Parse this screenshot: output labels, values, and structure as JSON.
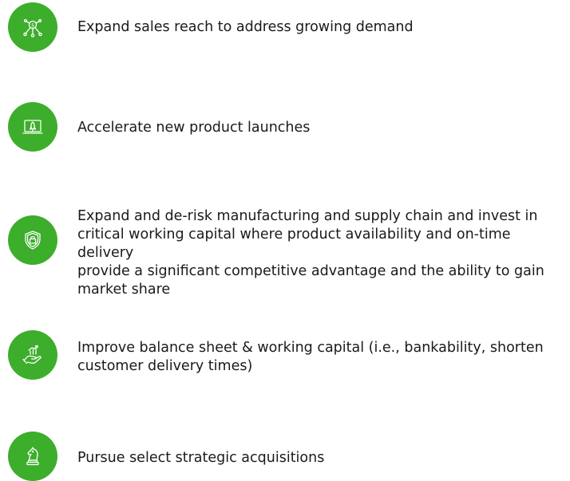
{
  "theme": {
    "accent": "#3dae2b",
    "icon_stroke": "#ffffff",
    "text_color": "#1a1a1a"
  },
  "items": [
    {
      "icon": "sales-network-icon",
      "text": "Expand sales reach to address growing demand"
    },
    {
      "icon": "rocket-launch-icon",
      "text": "Accelerate new product launches"
    },
    {
      "icon": "shield-lock-icon",
      "text": "Expand and de-risk manufacturing and supply chain and invest in\ncritical working capital where product availability and on-time delivery\nprovide a significant competitive advantage and the ability to gain\nmarket share"
    },
    {
      "icon": "hand-growth-chart-icon",
      "text": "Improve balance sheet & working capital (i.e., bankability, shorten\ncustomer delivery times)"
    },
    {
      "icon": "chess-knight-icon",
      "text": "Pursue select strategic acquisitions"
    }
  ]
}
